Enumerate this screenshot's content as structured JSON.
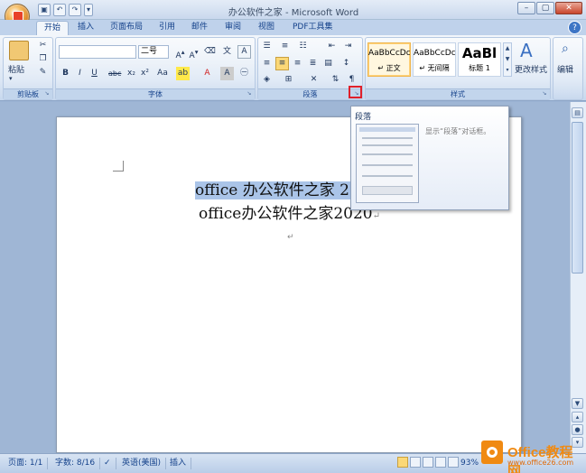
{
  "window": {
    "title": "办公软件之家 - Microsoft Word"
  },
  "tabs": [
    {
      "label": "开始"
    },
    {
      "label": "插入"
    },
    {
      "label": "页面布局"
    },
    {
      "label": "引用"
    },
    {
      "label": "邮件"
    },
    {
      "label": "审阅"
    },
    {
      "label": "视图"
    },
    {
      "label": "PDF工具集"
    }
  ],
  "groups": {
    "clipboard": {
      "label": "剪贴板",
      "paste_label": "粘贴"
    },
    "font": {
      "label": "字体",
      "font_name": "",
      "font_size": "二号"
    },
    "paragraph": {
      "label": "段落"
    },
    "styles": {
      "label": "样式",
      "items": [
        {
          "sample": "AaBbCcDc",
          "name": "↵ 正文"
        },
        {
          "sample": "AaBbCcDc",
          "name": "↵ 无间隔"
        },
        {
          "sample": "AaBl",
          "name": "标题 1"
        }
      ],
      "change_label": "更改样式"
    },
    "editing": {
      "label": "编辑"
    }
  },
  "tooltip": {
    "title": "段落",
    "description": "显示“段落”对话框。"
  },
  "document": {
    "line1": "office 办公软件之家 2020",
    "line1_mark": "↵",
    "line2": "office办公软件之家2020",
    "line2_mark": "↵",
    "line3_mark": "↵"
  },
  "status": {
    "page": "页面: 1/1",
    "words": "字数: 8/16",
    "language": "英语(美国)",
    "mode": "插入",
    "zoom": "93%"
  },
  "watermark": {
    "brand": "Office教程网",
    "url": "www.office26.com"
  },
  "colors": {
    "accent": "#15428b",
    "ribbon": "#dbe6f4",
    "selection": "#aac4e8",
    "highlight": "#e0202a"
  }
}
